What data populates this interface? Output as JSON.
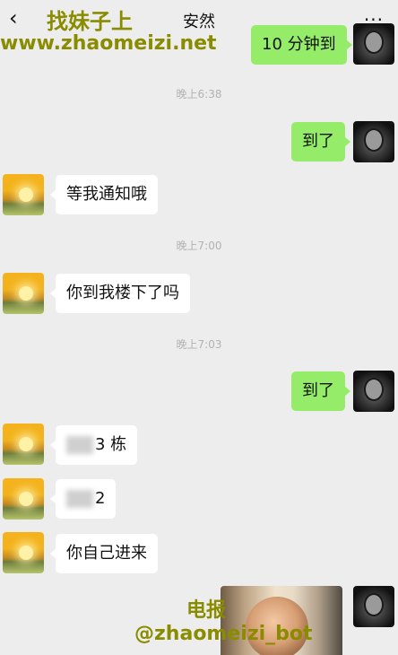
{
  "header": {
    "back_icon": "chevron-left-icon",
    "title": "安然",
    "more_icon": "more-dots-icon"
  },
  "watermarks": {
    "top_line1": "找妹子上",
    "top_line2": "www.zhaomeizi.net",
    "bottom_line1": "电报",
    "bottom_line2": "@zhaomeizi_bot"
  },
  "messages": [
    {
      "type": "text",
      "sender": "self",
      "text": "10 分钟到"
    },
    {
      "type": "time",
      "text": "晚上6:38"
    },
    {
      "type": "text",
      "sender": "self",
      "text": "到了"
    },
    {
      "type": "text",
      "sender": "other",
      "text": "等我通知哦"
    },
    {
      "type": "time",
      "text": "晚上7:00"
    },
    {
      "type": "text",
      "sender": "other",
      "text": "你到我楼下了吗"
    },
    {
      "type": "time",
      "text": "晚上7:03"
    },
    {
      "type": "text",
      "sender": "self",
      "text": "到了"
    },
    {
      "type": "text",
      "sender": "other",
      "text": "3 栋"
    },
    {
      "type": "text",
      "sender": "other",
      "text": "2"
    },
    {
      "type": "text",
      "sender": "other",
      "text": "你自己进来"
    },
    {
      "type": "image",
      "sender": "self"
    }
  ],
  "colors": {
    "background": "#ededed",
    "self_bubble": "#95ec69",
    "other_bubble": "#ffffff",
    "timestamp": "#b2b2b2",
    "watermark": "#8a8c00"
  }
}
